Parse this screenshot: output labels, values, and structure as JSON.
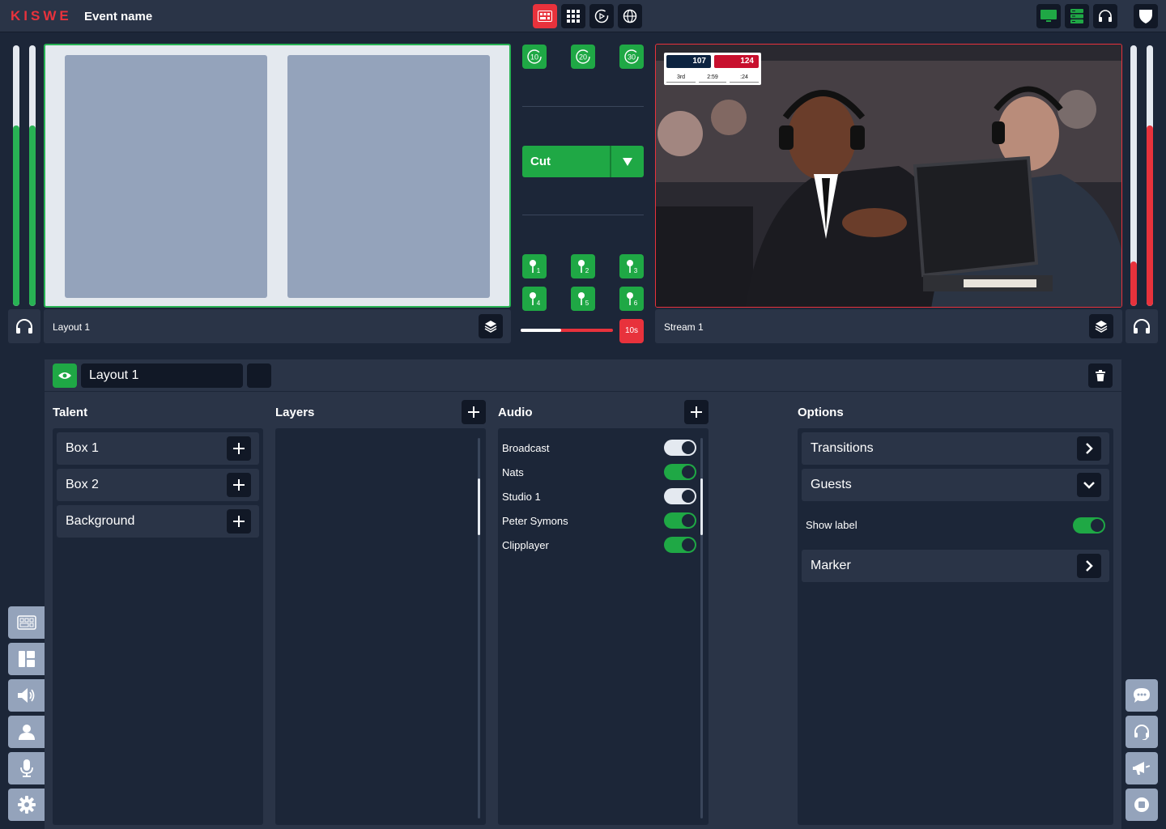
{
  "app": {
    "logo": "KISWE",
    "event_name": "Event name"
  },
  "toolbar": {
    "buttons": [
      "multiview-icon",
      "grid-icon",
      "replay-icon",
      "globe-icon"
    ],
    "right_buttons": [
      "monitor-icon",
      "server-icon",
      "headset-icon",
      "shield-icon"
    ]
  },
  "meters": {
    "preview_left": [
      0.72,
      0.7
    ],
    "program_right": [
      0.17,
      0.7
    ]
  },
  "preview": {
    "label": "Layout 1"
  },
  "program": {
    "label": "Stream 1",
    "scoreboard": {
      "home_score": "107",
      "away_score": "124",
      "period": "3rd",
      "clock": "2:59",
      "shot_clock": ":24"
    }
  },
  "controls": {
    "rewind": [
      "10",
      "20",
      "30"
    ],
    "cut_label": "Cut",
    "markers": [
      "1",
      "2",
      "3",
      "4",
      "5",
      "6"
    ],
    "transition_progress": 0.44,
    "duration": "10s"
  },
  "editor": {
    "layout_name": "Layout 1",
    "talent": {
      "title": "Talent",
      "items": [
        "Box 1",
        "Box 2",
        "Background"
      ]
    },
    "layers": {
      "title": "Layers"
    },
    "audio": {
      "title": "Audio",
      "items": [
        {
          "label": "Broadcast",
          "on": false
        },
        {
          "label": "Nats",
          "on": true
        },
        {
          "label": "Studio 1",
          "on": false
        },
        {
          "label": "Peter Symons",
          "on": true
        },
        {
          "label": "Clipplayer",
          "on": true
        }
      ]
    },
    "options": {
      "title": "Options",
      "transitions": "Transitions",
      "guests": "Guests",
      "show_label": "Show label",
      "show_label_on": true,
      "marker": "Marker"
    }
  },
  "colors": {
    "accent_green": "#1fa845",
    "accent_red": "#e8323c",
    "panel": "#2a3447",
    "background": "#1c2638"
  }
}
